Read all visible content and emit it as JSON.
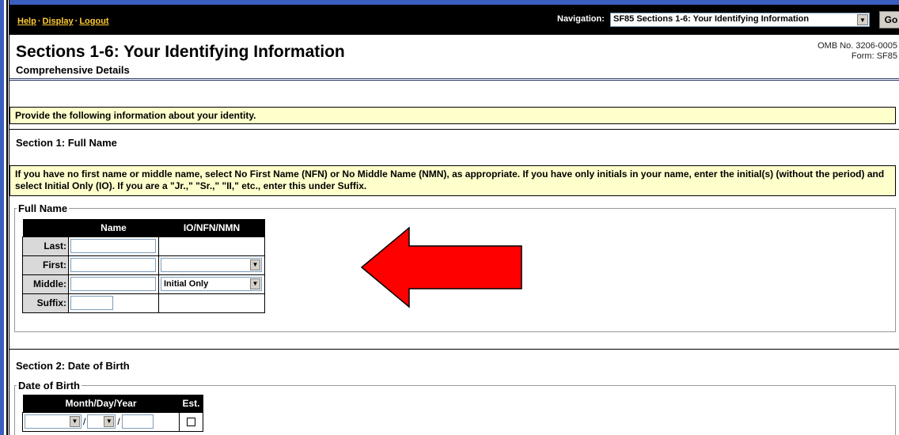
{
  "topbar": {
    "links": [
      "Help",
      "Display",
      "Logout"
    ],
    "link_sep": "·",
    "nav_label": "Navigation:",
    "nav_selected": "SF85 Sections 1-6: Your Identifying Information",
    "go_label": "Go"
  },
  "header": {
    "title": "Sections 1-6: Your Identifying Information",
    "subtitle": "Comprehensive Details",
    "omb_line1": "OMB No. 3206-0005",
    "omb_line2": "Form: SF85"
  },
  "intro": "Provide the following information about your identity.",
  "section1": {
    "title": "Section 1: Full Name",
    "instructions": "If you have no first name or middle name, select No First Name (NFN) or No Middle Name (NMN), as appropriate. If you have only initials in your name, enter the initial(s) (without the period) and select Initial Only (IO). If you are a \"Jr.,\" \"Sr.,\" \"II,\" etc., enter this under Suffix.",
    "legend": "Full Name",
    "col_name": "Name",
    "col_io": "IO/NFN/NMN",
    "rows": [
      {
        "label": "Last:",
        "io": null
      },
      {
        "label": "First:",
        "io": ""
      },
      {
        "label": "Middle:",
        "io": "Initial Only"
      },
      {
        "label": "Suffix:",
        "io": null
      }
    ]
  },
  "section2": {
    "title": "Section 2: Date of Birth",
    "legend": "Date of Birth",
    "col_date": "Month/Day/Year",
    "col_est": "Est.",
    "date_sep": "/"
  },
  "colors": {
    "topbar_bg": "#000000",
    "link": "#ffcc33",
    "band_bg": "#ffffcc",
    "arrow": "#ff0000",
    "frame": "#3a5fbf"
  }
}
